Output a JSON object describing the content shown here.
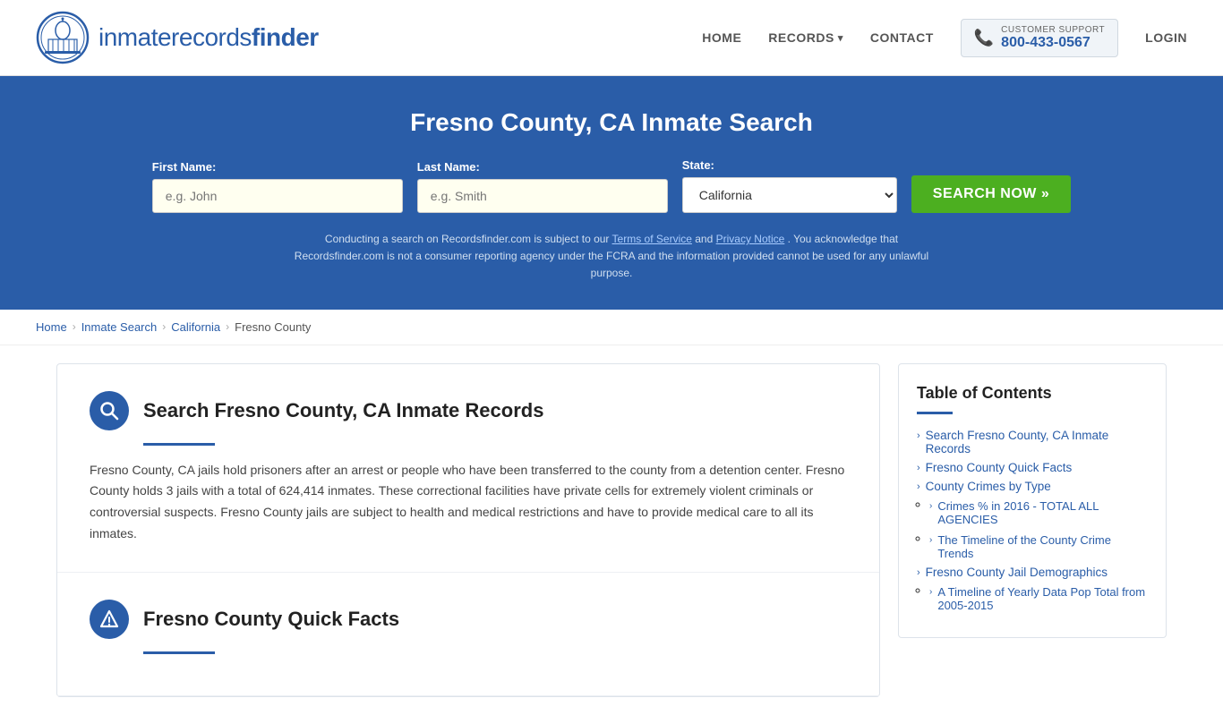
{
  "header": {
    "logo_text_regular": "inmaterecords",
    "logo_text_bold": "finder",
    "nav": {
      "home": "HOME",
      "records": "RECORDS",
      "contact": "CONTACT",
      "login": "LOGIN"
    },
    "support": {
      "label": "CUSTOMER SUPPORT",
      "phone": "800-433-0567"
    }
  },
  "hero": {
    "title": "Fresno County, CA Inmate Search",
    "form": {
      "first_name_label": "First Name:",
      "first_name_placeholder": "e.g. John",
      "last_name_label": "Last Name:",
      "last_name_placeholder": "e.g. Smith",
      "state_label": "State:",
      "state_value": "California",
      "search_button": "SEARCH NOW »"
    },
    "disclaimer": "Conducting a search on Recordsfinder.com is subject to our Terms of Service and Privacy Notice. You acknowledge that Recordsfinder.com is not a consumer reporting agency under the FCRA and the information provided cannot be used for any unlawful purpose."
  },
  "breadcrumb": {
    "items": [
      "Home",
      "Inmate Search",
      "California",
      "Fresno County"
    ]
  },
  "main_content": {
    "sections": [
      {
        "id": "inmate-records",
        "icon": "🔍",
        "icon_type": "search",
        "title": "Search Fresno County, CA Inmate Records",
        "text": "Fresno County, CA jails hold prisoners after an arrest or people who have been transferred to the county from a detention center. Fresno County holds 3 jails with a total of 624,414 inmates. These correctional facilities have private cells for extremely violent criminals or controversial suspects. Fresno County jails are subject to health and medical restrictions and have to provide medical care to all its inmates."
      },
      {
        "id": "quick-facts",
        "icon": "⚠",
        "icon_type": "alert",
        "title": "Fresno County Quick Facts",
        "text": ""
      }
    ]
  },
  "toc": {
    "title": "Table of Contents",
    "items": [
      {
        "label": "Search Fresno County, CA Inmate Records",
        "href": "#inmate-records",
        "sub": []
      },
      {
        "label": "Fresno County Quick Facts",
        "href": "#quick-facts",
        "sub": []
      },
      {
        "label": "County Crimes by Type",
        "href": "#crimes-by-type",
        "sub": [
          {
            "label": "Crimes % in 2016 - TOTAL ALL AGENCIES",
            "href": "#crimes-2016"
          },
          {
            "label": "The Timeline of the County Crime Trends",
            "href": "#crime-trends"
          }
        ]
      },
      {
        "label": "Fresno County Jail Demographics",
        "href": "#jail-demographics",
        "sub": [
          {
            "label": "A Timeline of Yearly Data Pop Total from 2005-2015",
            "href": "#yearly-data"
          }
        ]
      }
    ]
  }
}
